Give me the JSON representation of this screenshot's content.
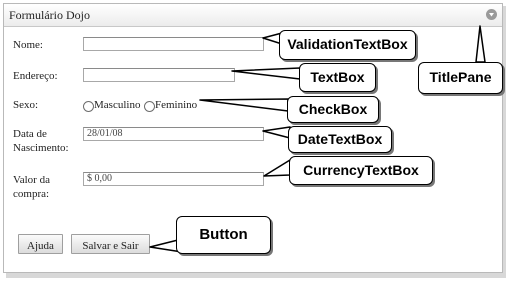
{
  "pane": {
    "title": "Formulário Dojo"
  },
  "form": {
    "nome_label": "Nome:",
    "nome_value": "",
    "endereco_label": "Endereço:",
    "endereco_value": "",
    "sexo_label": "Sexo:",
    "sexo_options": [
      "Masculino",
      "Feminino"
    ],
    "nascimento_label_line1": "Data de",
    "nascimento_label_line2": "Nascimento:",
    "nascimento_value": "28/01/08",
    "valor_label_line1": "Valor da",
    "valor_label_line2": "compra:",
    "valor_value": "$ 0,00"
  },
  "buttons": {
    "help": "Ajuda",
    "save_exit": "Salvar e Sair"
  },
  "callouts": {
    "validation": "ValidationTextBox",
    "textbox": "TextBox",
    "checkbox": "CheckBox",
    "datetextbox": "DateTextBox",
    "currency": "CurrencyTextBox",
    "titlepane": "TitlePane",
    "button": "Button"
  }
}
